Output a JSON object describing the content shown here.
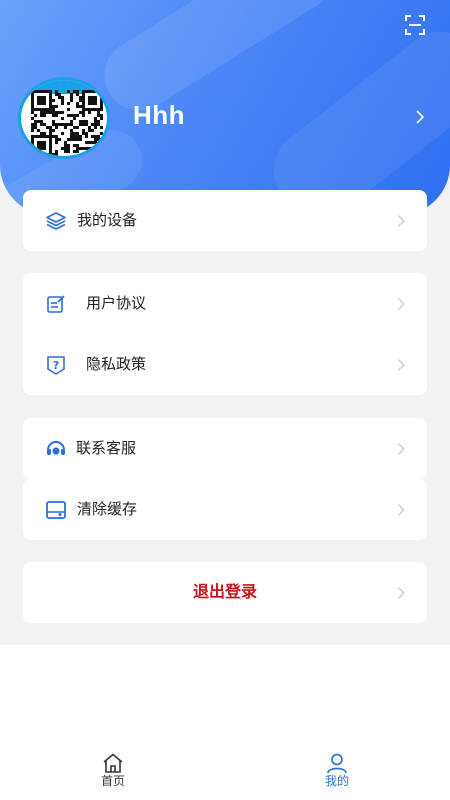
{
  "profile": {
    "username": "Hhh",
    "avatar_icon": "qr-code-avatar"
  },
  "menu": {
    "devices": {
      "label": "我的设备",
      "icon": "layers-icon"
    },
    "agreement": {
      "label": "用户协议",
      "icon": "document-edit-icon"
    },
    "privacy": {
      "label": "隐私政策",
      "icon": "shield-question-icon"
    },
    "support": {
      "label": "联系客服",
      "icon": "headset-icon"
    },
    "cache": {
      "label": "清除缓存",
      "icon": "wallet-icon"
    },
    "logout": {
      "label": "退出登录"
    }
  },
  "tabbar": {
    "home": {
      "label": "首页",
      "active": false
    },
    "mine": {
      "label": "我的",
      "active": true
    }
  },
  "colors": {
    "brand_blue": "#3b7cf5",
    "icon_blue": "#2d6fd6",
    "logout_red": "#c8161d",
    "tab_active": "#2e74d8",
    "tab_inactive": "#333333"
  }
}
